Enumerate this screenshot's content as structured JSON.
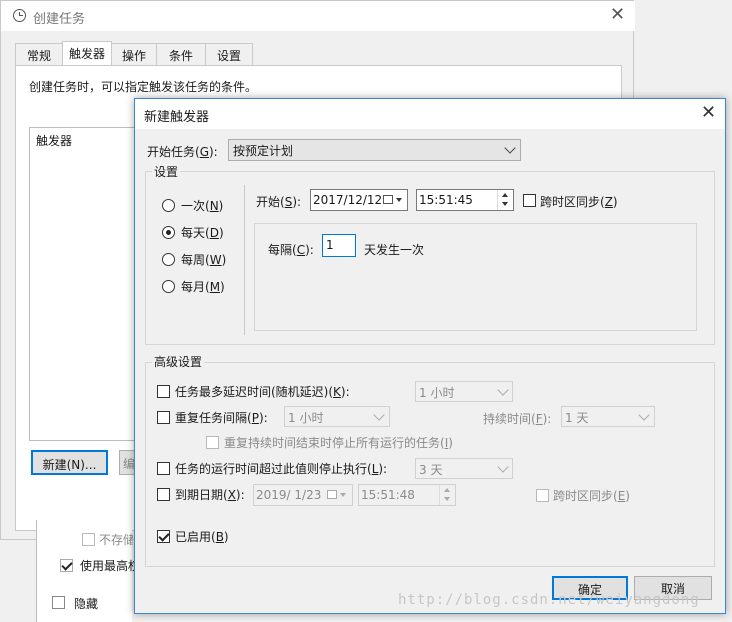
{
  "bg_window": {
    "title": "创建任务",
    "tabs": [
      "常规",
      "触发器",
      "操作",
      "条件",
      "设置"
    ],
    "description": "创建任务时，可以指定触发该任务的条件。",
    "list_header": "触发器",
    "new_button": "新建(N)...",
    "partial_button": "编",
    "partial_label": "不存储",
    "highest_label": "使用最高权",
    "hidden_label": "隐藏"
  },
  "dialog": {
    "title": "新建触发器",
    "start_task_label": "开始任务(G):",
    "start_task_value": "按预定计划",
    "settings_group": "设置",
    "schedule_options": [
      {
        "label": "一次(N)",
        "selected": false
      },
      {
        "label": "每天(D)",
        "selected": true
      },
      {
        "label": "每周(W)",
        "selected": false
      },
      {
        "label": "每月(M)",
        "selected": false
      }
    ],
    "start_label": "开始(S):",
    "start_date": "2017/12/12",
    "start_time": "15:51:45",
    "sync_tz_label": "跨时区同步(Z)",
    "recur_label": "每隔(C):",
    "recur_value": "1",
    "recur_suffix": "天发生一次",
    "advanced_group": "高级设置",
    "delay_label": "任务最多延迟时间(随机延迟)(K):",
    "delay_value": "1 小时",
    "repeat_label": "重复任务间隔(P):",
    "repeat_value": "1 小时",
    "duration_label": "持续时间(F):",
    "duration_value": "1 天",
    "stop_all_label": "重复持续时间结束时停止所有运行的任务(I)",
    "stop_longer_label": "任务的运行时间超过此值则停止执行(L):",
    "stop_longer_value": "3 天",
    "expire_label": "到期日期(X):",
    "expire_date": "2019/ 1/23",
    "expire_time": "15:51:48",
    "expire_sync_label": "跨时区同步(E)",
    "enabled_label": "已启用(B)",
    "ok_button": "确定",
    "cancel_button": "取消"
  },
  "watermark": "http://blog.csdn.net/weiyangdong"
}
